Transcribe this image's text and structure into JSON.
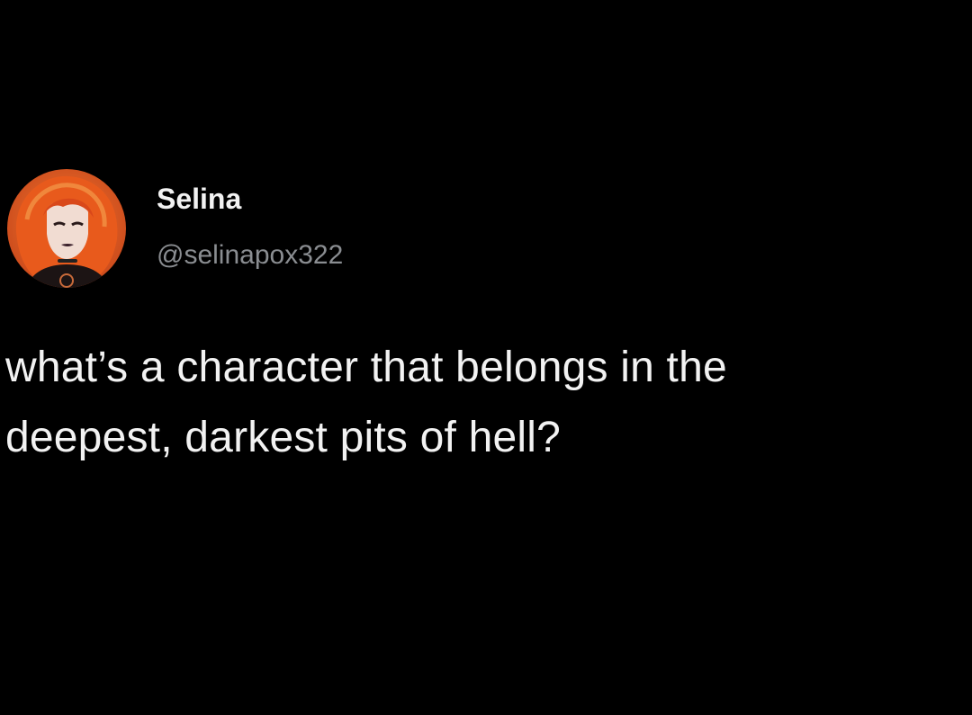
{
  "tweet": {
    "author": {
      "display_name": "Selina",
      "handle": "@selinapox322",
      "avatar_icon": "profile-avatar-icon"
    },
    "text": "what’s a character that belongs in the\ndeepest, darkest pits of hell?"
  },
  "colors": {
    "background": "#000000",
    "text_primary": "#f2f2f2",
    "text_secondary": "#8a8d91",
    "avatar_hair": "#e2581e"
  }
}
